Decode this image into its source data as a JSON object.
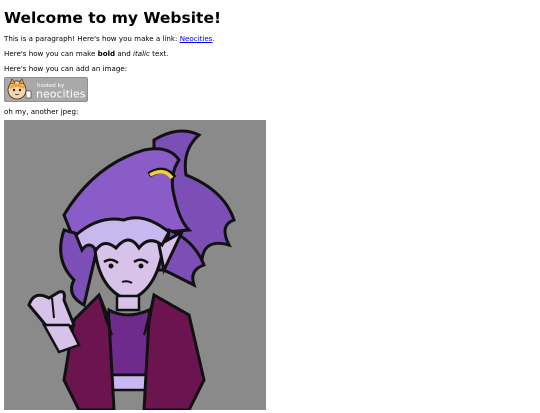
{
  "heading": "Welcome to my Website!",
  "para1": {
    "before": "This is a paragraph! Here's how you make a link: ",
    "link_text": "Neocities",
    "after": "."
  },
  "para2": {
    "before": "Here's how you can make ",
    "bold": "bold",
    "middle": " and ",
    "italic": "italic",
    "after": " text."
  },
  "para3": "Here's how you can add an image:",
  "badge": {
    "line1": "hosted by",
    "line2": "neocities"
  },
  "para4": "oh my, another jpeg:",
  "colors": {
    "link": "#0000ee",
    "badge_bg": "#a9a9a9",
    "art_bg": "#8a8a8a",
    "hair": "#7b4fb6",
    "skin": "#d7c3ea",
    "jacket": "#6b1450"
  }
}
